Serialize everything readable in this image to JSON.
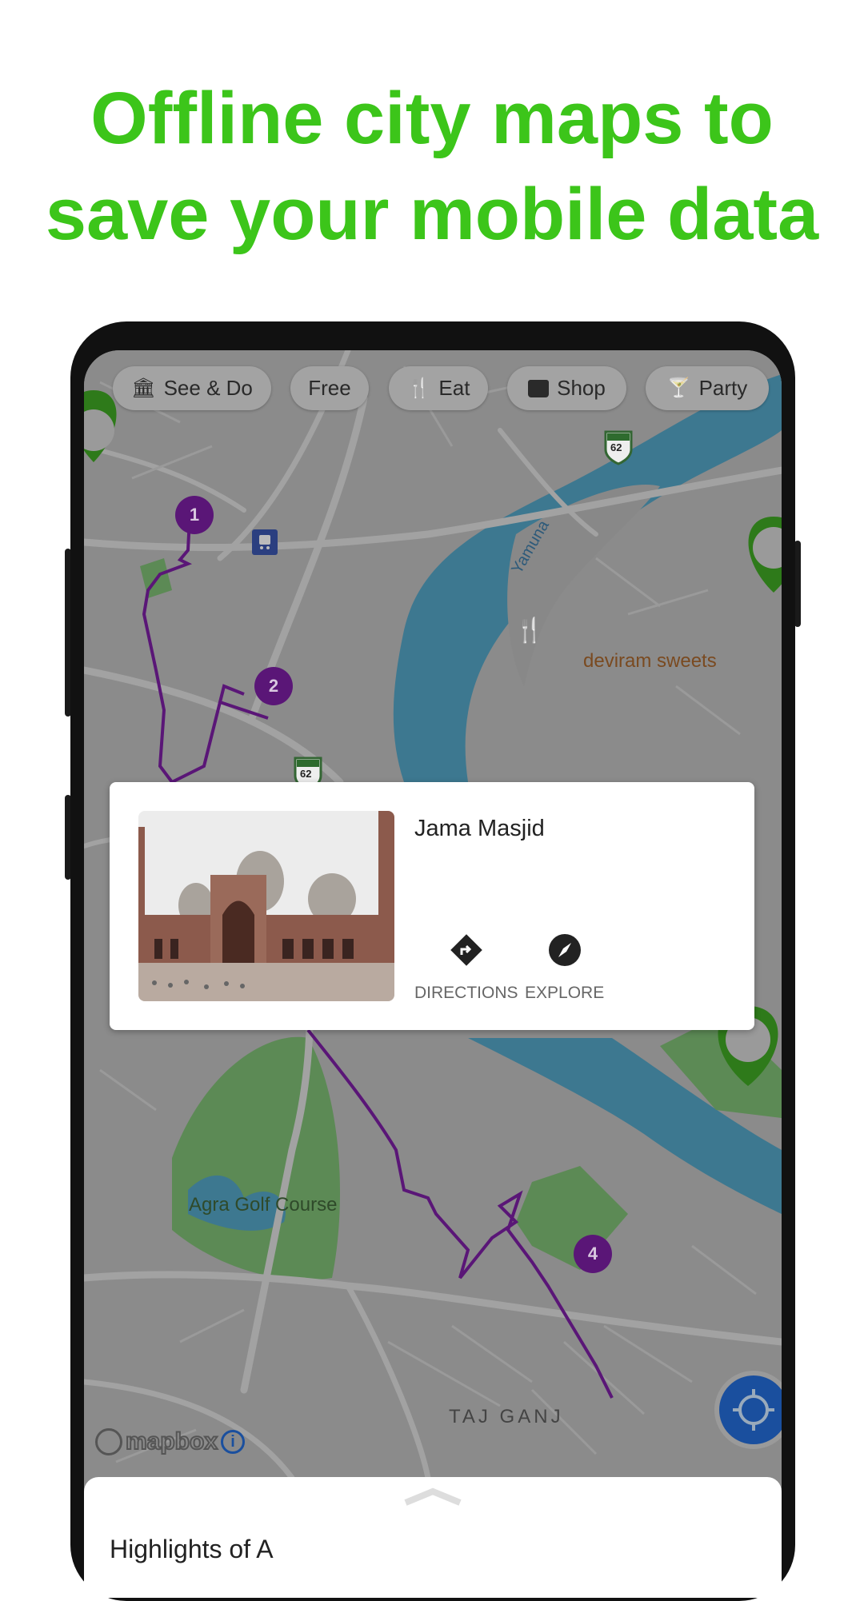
{
  "headline": {
    "line1": "Offline city maps to",
    "line2": "save your mobile data",
    "color": "#3cc51a"
  },
  "categories": [
    {
      "label": "See & Do",
      "icon": "museum-icon"
    },
    {
      "label": "Free",
      "icon": ""
    },
    {
      "label": "Eat",
      "icon": "fork-knife-icon"
    },
    {
      "label": "Shop",
      "icon": "shopping-bag-icon"
    },
    {
      "label": "Party",
      "icon": "cocktail-icon"
    }
  ],
  "map": {
    "labels": {
      "river": "Yamuna",
      "restaurant": "deviram sweets",
      "golf": "Agra Golf Course",
      "district": "TAJ GANJ",
      "highway": "62"
    },
    "route_markers": [
      "1",
      "2",
      "4"
    ],
    "route_color": "#5a1677",
    "attribution": "mapbox"
  },
  "place_card": {
    "title": "Jama Masjid",
    "actions": [
      {
        "label": "DIRECTIONS",
        "icon": "directions-icon"
      },
      {
        "label": "EXPLORE",
        "icon": "compass-icon"
      }
    ]
  },
  "bottom_sheet": {
    "title": "Highlights of A"
  }
}
